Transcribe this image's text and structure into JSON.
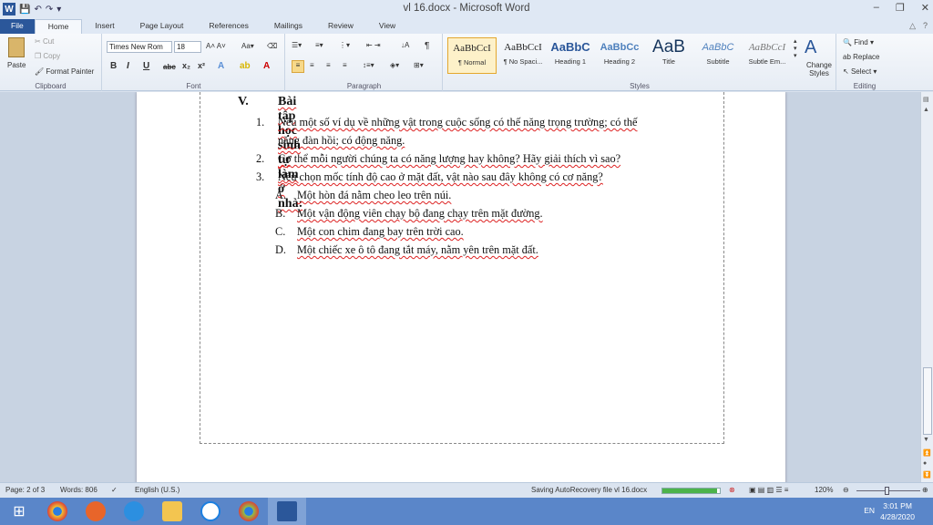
{
  "window": {
    "title": "vl 16.docx - Microsoft Word",
    "controls": [
      "–",
      "❐",
      "✕"
    ]
  },
  "tabs": [
    {
      "label": "File"
    },
    {
      "label": "Home"
    },
    {
      "label": "Insert"
    },
    {
      "label": "Page Layout"
    },
    {
      "label": "References"
    },
    {
      "label": "Mailings"
    },
    {
      "label": "Review"
    },
    {
      "label": "View"
    }
  ],
  "ribbon": {
    "clipboard": {
      "paste": "Paste",
      "cut": "Cut",
      "copy": "Copy",
      "format_painter": "Format Painter",
      "label": "Clipboard"
    },
    "font": {
      "name": "Times New Rom",
      "size": "18",
      "label": "Font"
    },
    "paragraph": {
      "label": "Paragraph"
    },
    "styles": {
      "label": "Styles",
      "items": [
        {
          "sample": "AaBbCcI",
          "name": "¶ Normal"
        },
        {
          "sample": "AaBbCcI",
          "name": "¶ No Spaci..."
        },
        {
          "sample": "AaBbC",
          "name": "Heading 1"
        },
        {
          "sample": "AaBbCc",
          "name": "Heading 2"
        },
        {
          "sample": "AaB",
          "name": "Title"
        },
        {
          "sample": "AaBbC",
          "name": "Subtitle"
        },
        {
          "sample": "AaBbCcI",
          "name": "Subtle Em..."
        }
      ],
      "change_styles": "Change Styles"
    },
    "editing": {
      "find": "Find",
      "replace": "Replace",
      "select": "Select",
      "label": "Editing"
    }
  },
  "document": {
    "heading_num": "V.",
    "heading_text": "Bài tập học sinh tự làm ở nhà:",
    "items": [
      {
        "num": "1.",
        "line1": "Nêu một số ví dụ về những vật trong cuộc sống có thế năng trọng trường; có thế",
        "line2": "năng đàn hồi; có động năng."
      },
      {
        "num": "2.",
        "line1": "Cơ thể mỗi người chúng ta có năng lượng hay không? Hãy giải thích vì sao?"
      },
      {
        "num": "3.",
        "line1": "Nếu chọn mốc tính độ cao ở mặt đất, vật nào sau đây không có cơ năng?"
      }
    ],
    "options": [
      {
        "letter": "A.",
        "text": "Một hòn đá nằm cheo leo trên núi."
      },
      {
        "letter": "B.",
        "text": "Một vận động viên chạy bộ đang chạy trên mặt đường."
      },
      {
        "letter": "C.",
        "text": "Một con chim đang bay trên trời cao."
      },
      {
        "letter": "D.",
        "text": "Một chiếc xe ô tô đang tắt máy, nằm yên trên mặt đất."
      }
    ]
  },
  "status": {
    "page": "Page: 2 of 3",
    "words": "Words: 806",
    "language": "English (U.S.)",
    "saving": "Saving AutoRecovery file vl 16.docx",
    "save_progress": 0.95,
    "zoom": "120%"
  },
  "taskbar": {
    "lang": "EN",
    "time": "3:01 PM",
    "date": "4/28/2020"
  },
  "colors": {
    "accent": "#2b579a",
    "taskbar": "#5a86c9",
    "progress": "#4cb34a"
  }
}
